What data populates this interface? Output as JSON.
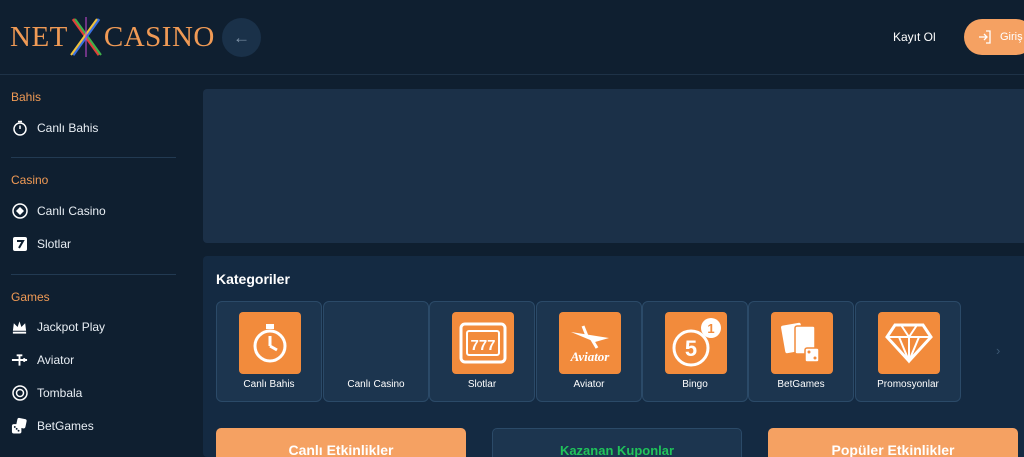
{
  "header": {
    "logo_left": "NET",
    "logo_right": "CASINO",
    "register_label": "Kayıt Ol",
    "login_label": "Giriş"
  },
  "sidebar": {
    "sections": [
      {
        "title": "Bahis",
        "items": [
          {
            "label": "Canlı Bahis",
            "icon": "stopwatch-icon"
          }
        ]
      },
      {
        "title": "Casino",
        "items": [
          {
            "label": "Canlı Casino",
            "icon": "chip-icon"
          },
          {
            "label": "Slotlar",
            "icon": "seven-icon"
          }
        ]
      },
      {
        "title": "Games",
        "items": [
          {
            "label": "Jackpot Play",
            "icon": "crown-icon"
          },
          {
            "label": "Aviator",
            "icon": "plane-icon"
          },
          {
            "label": "Tombala",
            "icon": "ball-icon"
          },
          {
            "label": "BetGames",
            "icon": "dice-icon"
          }
        ]
      }
    ]
  },
  "categories": {
    "title": "Kategoriler",
    "items": [
      {
        "label": "Canlı Bahis",
        "icon": "stopwatch-icon"
      },
      {
        "label": "Canlı Casino",
        "icon": ""
      },
      {
        "label": "Slotlar",
        "icon": "slot-machine-icon"
      },
      {
        "label": "Aviator",
        "icon": "aviator-icon",
        "tile_text": "Aviator"
      },
      {
        "label": "Bingo",
        "icon": "bingo-ball-icon",
        "ball_main": "5",
        "ball_badge": "1"
      },
      {
        "label": "BetGames",
        "icon": "cards-dice-icon"
      },
      {
        "label": "Promosyonlar",
        "icon": "diamond-icon"
      }
    ],
    "slot_digits": "777"
  },
  "bottom_buttons": [
    {
      "label": "Canlı Etkinlikler"
    },
    {
      "label": "Kazanan Kuponlar"
    },
    {
      "label": "Popüler Etkinlikler"
    }
  ],
  "colors": {
    "background": "#0f1f30",
    "accent": "#f09a55",
    "tile_orange": "#f28b3c",
    "winning_green": "#1fc45a"
  }
}
